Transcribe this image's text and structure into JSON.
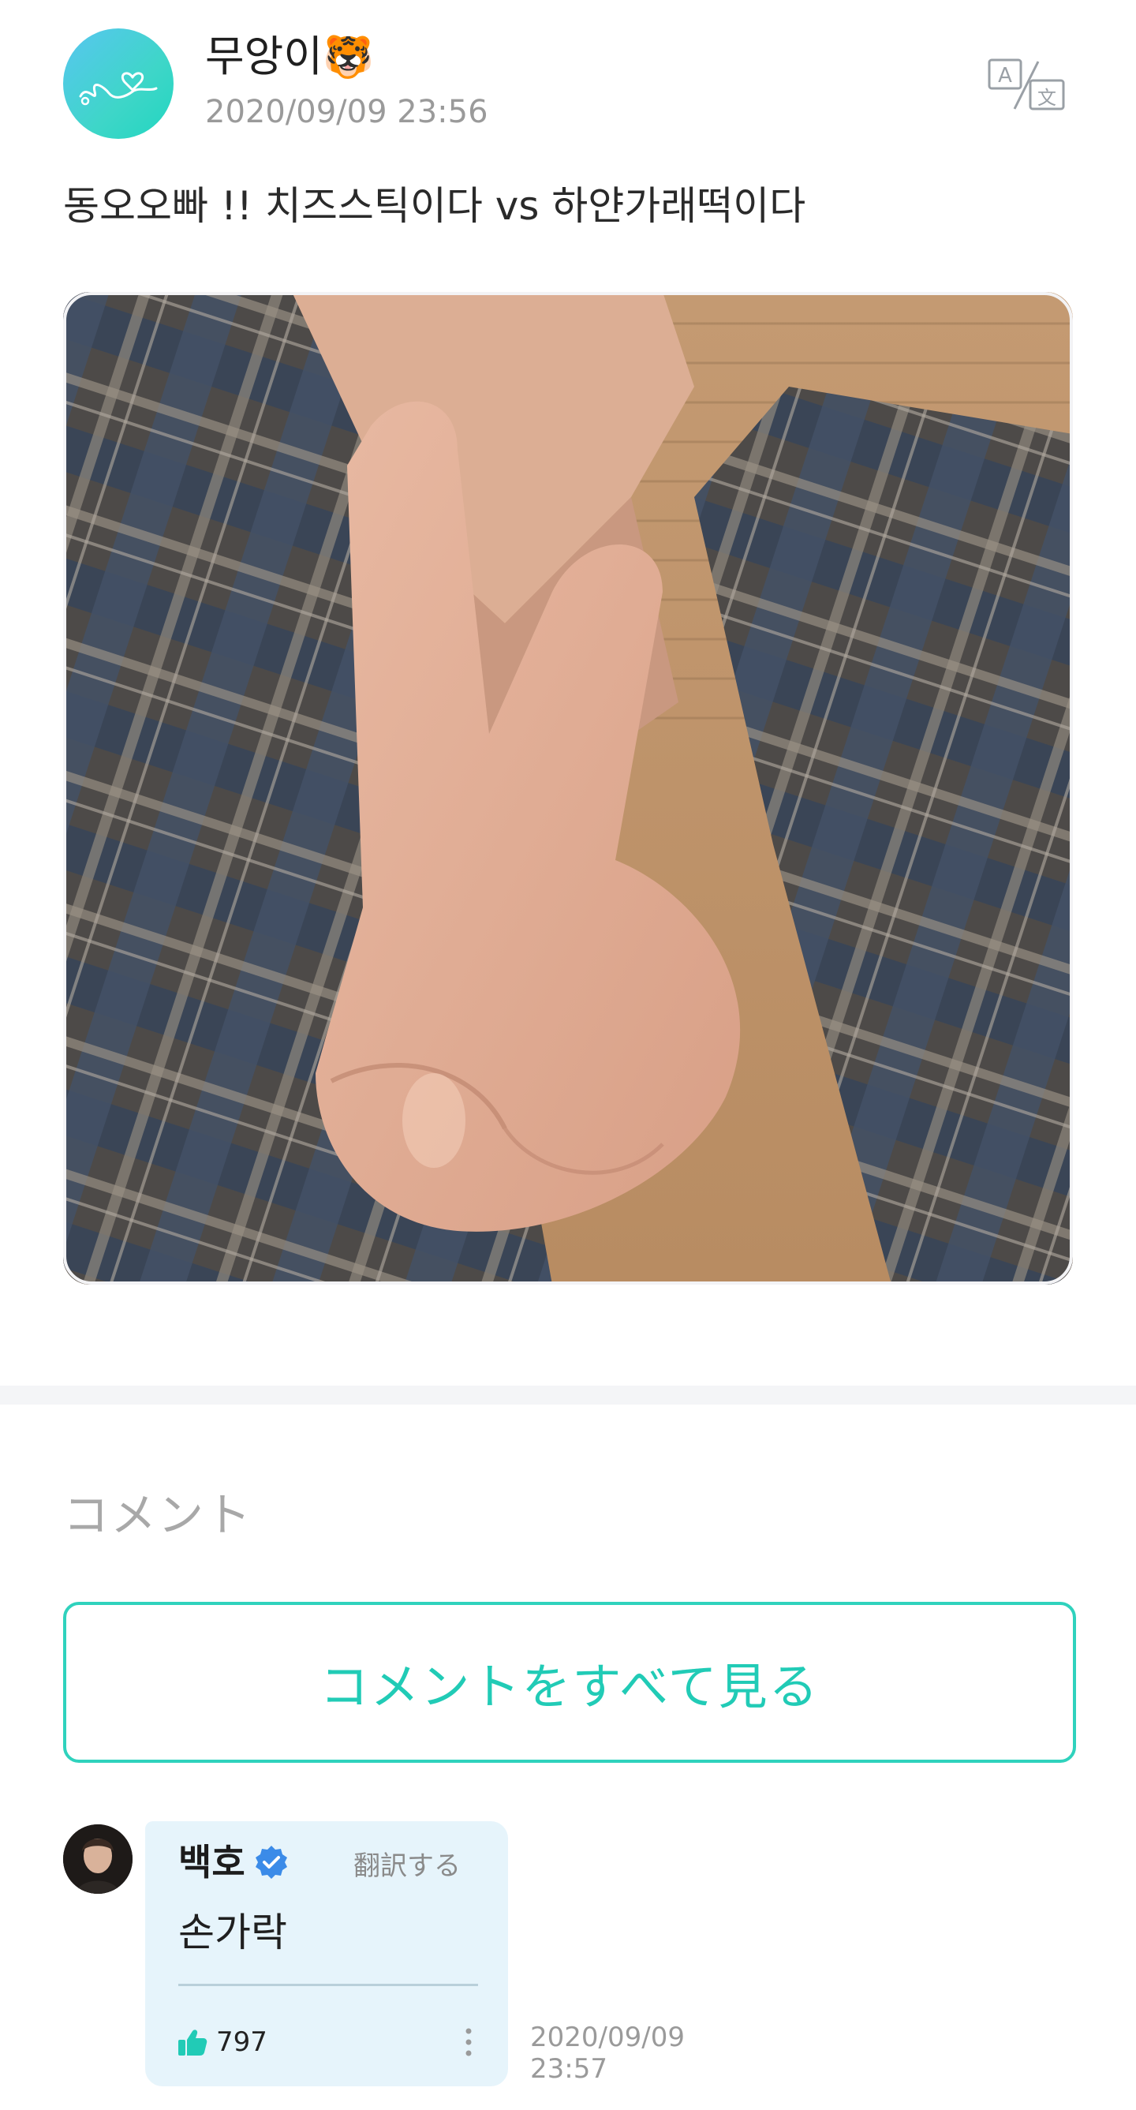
{
  "post": {
    "author_name": "무앙이",
    "author_emoji": "🐯",
    "time": "2020/09/09 23:56",
    "text": "동오오빠 !! 치즈스틱이다 vs 하얀가래떡이다",
    "icons": {
      "avatar": "heart-scribble-avatar",
      "translate": "translate-icon"
    },
    "photo_description_icon": "peace-sign-photo"
  },
  "comments_section": {
    "heading": "コメント",
    "view_all_label": "コメントをすべて見る"
  },
  "comments": [
    {
      "name": "백호",
      "verified": true,
      "translate_label": "翻訳する",
      "text": "손가락",
      "likes": "797",
      "time_date": "2020/09/09",
      "time_clock": "23:57"
    }
  ],
  "colors": {
    "accent": "#21cbb6",
    "bubble": "#e6f4fb",
    "verified": "#3b8be8"
  }
}
